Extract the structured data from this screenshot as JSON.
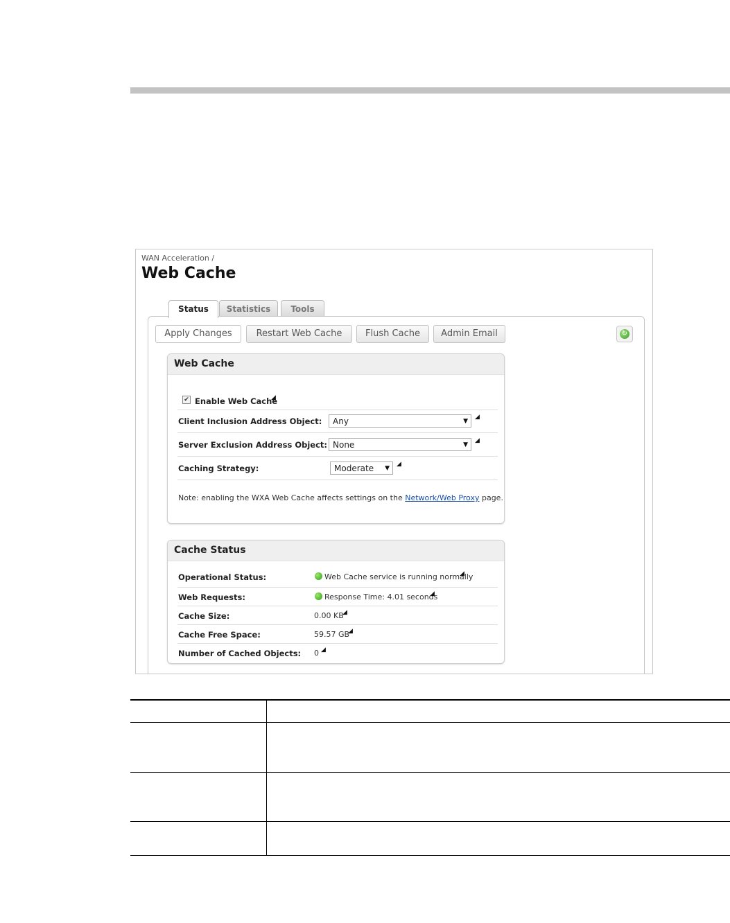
{
  "breadcrumb": "WAN Acceleration /",
  "page_title": "Web Cache",
  "tabs": [
    {
      "label": "Status",
      "active": true
    },
    {
      "label": "Statistics",
      "active": false
    },
    {
      "label": "Tools",
      "active": false
    }
  ],
  "toolbar": {
    "apply": "Apply Changes",
    "restart": "Restart Web Cache",
    "flush": "Flush Cache",
    "admin_email": "Admin Email",
    "refresh_icon": "refresh-icon"
  },
  "web_cache": {
    "title": "Web Cache",
    "enable_label": "Enable Web Cache",
    "enable_checked": true,
    "client_inclusion_label": "Client Inclusion Address Object:",
    "client_inclusion_value": "Any",
    "server_exclusion_label": "Server Exclusion Address Object:",
    "server_exclusion_value": "None",
    "caching_strategy_label": "Caching Strategy:",
    "caching_strategy_value": "Moderate",
    "note_prefix": "Note: enabling the WXA Web Cache affects settings on the ",
    "note_link": "Network/Web Proxy",
    "note_suffix": " page."
  },
  "cache_status": {
    "title": "Cache Status",
    "rows": [
      {
        "label": "Operational Status:",
        "value": "Web Cache service is running normally",
        "indicator": "green"
      },
      {
        "label": "Web Requests:",
        "value": "Response Time: 4.01 seconds",
        "indicator": "green"
      },
      {
        "label": "Cache Size:",
        "value": "0.00 KB"
      },
      {
        "label": "Cache Free Space:",
        "value": "59.57 GB"
      },
      {
        "label": "Number of Cached Objects:",
        "value": "0"
      }
    ]
  },
  "colors": {
    "link": "#1a4fa8",
    "status_green": "#3faa1e",
    "rule_gray": "#c3c3c3"
  },
  "description_table": {
    "rows": [
      {
        "c1": "",
        "c2": ""
      },
      {
        "c1": "",
        "c2": ""
      },
      {
        "c1": "",
        "c2": ""
      },
      {
        "c1": "",
        "c2": ""
      }
    ]
  }
}
